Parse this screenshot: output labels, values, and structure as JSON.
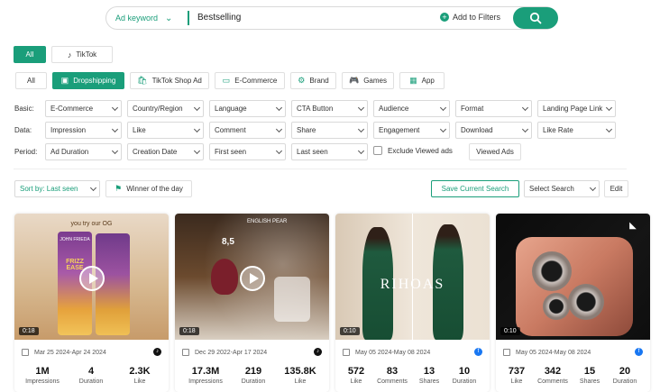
{
  "search": {
    "keyword_type": "Ad keyword",
    "query": "Bestselling",
    "add_filters": "Add to Filters"
  },
  "platform_tabs": [
    "All",
    "TikTok"
  ],
  "type_tabs": [
    "All",
    "Dropshipping",
    "TikTok Shop Ad",
    "E-Commerce",
    "Brand",
    "Games",
    "App"
  ],
  "rows": {
    "basic": {
      "label": "Basic:",
      "fields": [
        "E-Commerce",
        "Country/Region",
        "Language",
        "CTA Button",
        "Audience",
        "Format",
        "Landing Page Link"
      ]
    },
    "data": {
      "label": "Data:",
      "fields": [
        "Impression",
        "Like",
        "Comment",
        "Share",
        "Engagement",
        "Download",
        "Like Rate"
      ]
    },
    "period": {
      "label": "Period:",
      "fields": [
        "Ad Duration",
        "Creation Date",
        "First seen",
        "Last seen"
      ],
      "exclude": "Exclude Viewed ads",
      "viewed": "Viewed Ads"
    }
  },
  "toolbar": {
    "sort": "Sort by: Last seen",
    "winner": "Winner of the day",
    "save": "Save Current Search",
    "select_search": "Select Search",
    "edit": "Edit"
  },
  "colors": {
    "accent": "#1a9e7a"
  },
  "cards": [
    {
      "duration": "0:18",
      "date": "Mar 25 2024-Apr 24 2024",
      "platform": "tiktok-icon",
      "overlay_top": "you try our OG",
      "brand": "JOHN FRIEDA",
      "product": "FRIZZ EASE",
      "stats": [
        {
          "v": "1M",
          "k": "Impressions"
        },
        {
          "v": "4",
          "k": "Duration"
        },
        {
          "v": "2.3K",
          "k": "Like"
        }
      ]
    },
    {
      "duration": "0:18",
      "date": "Dec 29 2022-Apr 17 2024",
      "platform": "tiktok-icon",
      "overlay_top": "ENGLISH PEAR",
      "price": "8,5",
      "stats": [
        {
          "v": "17.3M",
          "k": "Impressions"
        },
        {
          "v": "219",
          "k": "Duration"
        },
        {
          "v": "135.8K",
          "k": "Like"
        }
      ]
    },
    {
      "duration": "0:10",
      "date": "May 05 2024-May 08 2024",
      "platform": "facebook-icon",
      "brand": "RIHOAS",
      "stats": [
        {
          "v": "572",
          "k": "Like"
        },
        {
          "v": "83",
          "k": "Comments"
        },
        {
          "v": "13",
          "k": "Shares"
        },
        {
          "v": "10",
          "k": "Duration"
        }
      ]
    },
    {
      "duration": "0:10",
      "date": "May 05 2024-May 08 2024",
      "platform": "facebook-icon",
      "stats": [
        {
          "v": "737",
          "k": "Like"
        },
        {
          "v": "342",
          "k": "Comments"
        },
        {
          "v": "15",
          "k": "Shares"
        },
        {
          "v": "20",
          "k": "Duration"
        }
      ]
    }
  ]
}
